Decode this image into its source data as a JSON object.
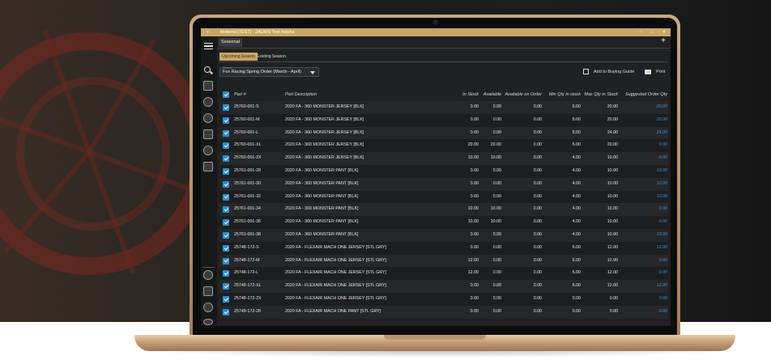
{
  "window": {
    "title": "Motlend [TEST] - 2ADMS Test #alpha",
    "add_symbol": "+",
    "controls": [
      "–",
      "□",
      "✕"
    ]
  },
  "sidebar": {
    "icons": [
      "menu-icon",
      "search-icon",
      "photo-icon",
      "tire-icon",
      "gear-wheel-icon",
      "document-icon",
      "helmet-icon",
      "target-icon",
      "tire-icon",
      "document-icon",
      "helmet-icon",
      "target-icon"
    ]
  },
  "tabs": {
    "main_tab": "Seasonal",
    "add_tab": "+",
    "subtabs": [
      "Upcoming Season",
      "Existing Season"
    ]
  },
  "season": {
    "label": "Season",
    "value": "Fox Racing Spring Order (March - April)"
  },
  "actions": {
    "add_to_buying_guide": "Add to Buying Guide",
    "print": "Print"
  },
  "colors": {
    "accent": "#c9a665",
    "checkbox": "#2b8fd6",
    "suggested_qty": "#3d9be0"
  },
  "table": {
    "columns": [
      "Part #",
      "Part Description",
      "In Stock",
      "Available",
      "Available on Order",
      "Min Qty in stock",
      "Max Qty in Stock",
      "Suggested Order Qty"
    ],
    "rows": [
      {
        "part": "25760-001-S",
        "desc": "2020 FA - 360 MONSTER JERSEY [BLK]",
        "in_stock": "0.00",
        "available": "0.00",
        "on_order": "0.00",
        "min": "6.00",
        "max": "20.00",
        "suggested": "20.00"
      },
      {
        "part": "25760-001-M",
        "desc": "2020 FA - 360 MONSTER JERSEY [BLK]",
        "in_stock": "0.00",
        "available": "0.00",
        "on_order": "0.00",
        "min": "8.00",
        "max": "20.00",
        "suggested": "20.00"
      },
      {
        "part": "25760-001-L",
        "desc": "2020 FA - 360 MONSTER JERSEY [BLK]",
        "in_stock": "0.00",
        "available": "0.00",
        "on_order": "0.00",
        "min": "8.00",
        "max": "24.00",
        "suggested": "24.00"
      },
      {
        "part": "25760-001-XL",
        "desc": "2020 FA - 360 MONSTER JERSEY [BLK]",
        "in_stock": "20.00",
        "available": "20.00",
        "on_order": "0.00",
        "min": "6.00",
        "max": "20.00",
        "suggested": "0.00"
      },
      {
        "part": "25760-001-2X",
        "desc": "2020 FA - 360 MONSTER JERSEY [BLK]",
        "in_stock": "10.00",
        "available": "10.00",
        "on_order": "0.00",
        "min": "4.00",
        "max": "10.00",
        "suggested": "0.00"
      },
      {
        "part": "25761-001-28",
        "desc": "2020 FA - 360 MONSTER PANT [BLK]",
        "in_stock": "0.00",
        "available": "0.00",
        "on_order": "0.00",
        "min": "4.00",
        "max": "10.00",
        "suggested": "10.00"
      },
      {
        "part": "25761-001-30",
        "desc": "2020 FA - 360 MONSTER PANT [BLK]",
        "in_stock": "0.00",
        "available": "0.00",
        "on_order": "0.00",
        "min": "4.00",
        "max": "10.00",
        "suggested": "10.00"
      },
      {
        "part": "25761-001-32",
        "desc": "2020 FA - 360 MONSTER PANT [BLK]",
        "in_stock": "0.00",
        "available": "0.00",
        "on_order": "0.00",
        "min": "4.00",
        "max": "10.00",
        "suggested": "10.00"
      },
      {
        "part": "25761-001-34",
        "desc": "2020 FA - 360 MONSTER PANT [BLK]",
        "in_stock": "10.00",
        "available": "10.00",
        "on_order": "0.00",
        "min": "4.00",
        "max": "10.00",
        "suggested": "0.00"
      },
      {
        "part": "25761-001-36",
        "desc": "2020 FA - 360 MONSTER PANT [BLK]",
        "in_stock": "10.00",
        "available": "10.00",
        "on_order": "0.00",
        "min": "4.00",
        "max": "10.00",
        "suggested": "0.00"
      },
      {
        "part": "25761-001-38",
        "desc": "2020 FA - 360 MONSTER PANT [BLK]",
        "in_stock": "0.00",
        "available": "0.00",
        "on_order": "0.00",
        "min": "4.00",
        "max": "10.00",
        "suggested": "10.00"
      },
      {
        "part": "25748-172-S",
        "desc": "2020 FA - FLEXAIR MACH ONE JERSEY [STL GRY]",
        "in_stock": "0.00",
        "available": "0.00",
        "on_order": "0.00",
        "min": "6.00",
        "max": "12.00",
        "suggested": "12.00"
      },
      {
        "part": "25748-172-M",
        "desc": "2020 FA - FLEXAIR MACH ONE JERSEY [STL GRY]",
        "in_stock": "12.00",
        "available": "0.00",
        "on_order": "0.00",
        "min": "6.00",
        "max": "12.00",
        "suggested": "0.00"
      },
      {
        "part": "25748-172-L",
        "desc": "2020 FA - FLEXAIR MACH ONE JERSEY [STL GRY]",
        "in_stock": "12.00",
        "available": "0.00",
        "on_order": "0.00",
        "min": "6.00",
        "max": "12.00",
        "suggested": "0.00"
      },
      {
        "part": "25748-172-XL",
        "desc": "2020 FA - FLEXAIR MACH ONE JERSEY [STL GRY]",
        "in_stock": "0.00",
        "available": "0.00",
        "on_order": "0.00",
        "min": "6.00",
        "max": "12.00",
        "suggested": "12.00"
      },
      {
        "part": "25748-172-2X",
        "desc": "2020 FA - FLEXAIR MACH ONE JERSEY [STL GRY]",
        "in_stock": "0.00",
        "available": "0.00",
        "on_order": "0.00",
        "min": "0.00",
        "max": "0.00",
        "suggested": "0.00"
      },
      {
        "part": "25749-172-28",
        "desc": "2020 FA - FLEXAIR MACH ONE PANT [STL GRY]",
        "in_stock": "0.00",
        "available": "0.00",
        "on_order": "0.00",
        "min": "0.00",
        "max": "0.00",
        "suggested": "0.00"
      }
    ]
  }
}
